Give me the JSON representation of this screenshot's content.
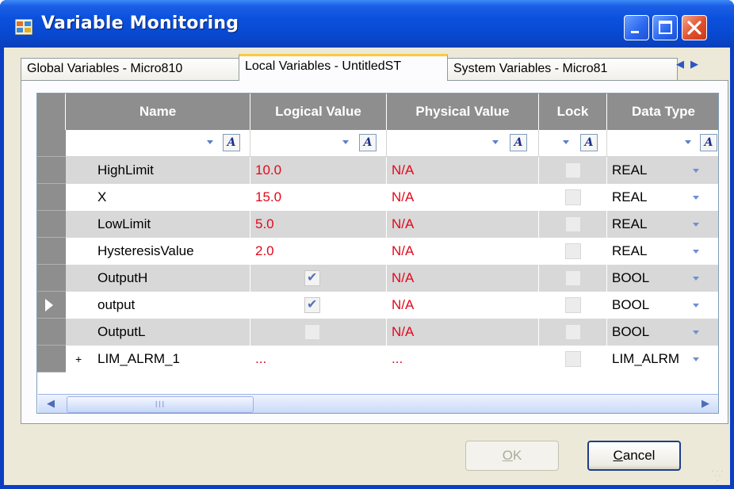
{
  "window": {
    "title": "Variable Monitoring",
    "colors": {
      "titlebar": "#0a50dc",
      "close": "#e0502d",
      "value_red": "#e2081c"
    }
  },
  "tabs": [
    {
      "label": "Global Variables - Micro810",
      "active": false
    },
    {
      "label": "Local Variables - UntitledST",
      "active": true
    },
    {
      "label": "System Variables - Micro81",
      "active": false
    }
  ],
  "tab_scroll_icons": [
    "chevron-left-icon",
    "chevron-right-icon"
  ],
  "grid": {
    "columns": [
      "Name",
      "Logical Value",
      "Physical Value",
      "Lock",
      "Data Type"
    ],
    "filter_icon": "text-filter-icon",
    "rows": [
      {
        "name": "HighLimit",
        "logical": "10.0",
        "physical": "N/A",
        "logical_kind": "text",
        "type": "REAL",
        "shaded": true
      },
      {
        "name": "X",
        "logical": "15.0",
        "physical": "N/A",
        "logical_kind": "text",
        "type": "REAL",
        "shaded": false
      },
      {
        "name": "LowLimit",
        "logical": "5.0",
        "physical": "N/A",
        "logical_kind": "text",
        "type": "REAL",
        "shaded": true
      },
      {
        "name": "HysteresisValue",
        "logical": "2.0",
        "physical": "N/A",
        "logical_kind": "text",
        "type": "REAL",
        "shaded": false
      },
      {
        "name": "OutputH",
        "logical_checked": true,
        "physical": "N/A",
        "logical_kind": "check",
        "type": "BOOL",
        "shaded": true
      },
      {
        "name": "output",
        "logical_checked": true,
        "physical": "N/A",
        "logical_kind": "check",
        "type": "BOOL",
        "shaded": false,
        "current": true
      },
      {
        "name": "OutputL",
        "logical_checked": false,
        "physical": "N/A",
        "logical_kind": "check",
        "type": "BOOL",
        "shaded": true
      },
      {
        "name": "LIM_ALRM_1",
        "logical": "...",
        "physical": "...",
        "logical_kind": "text",
        "type": "LIM_ALRM",
        "shaded": false,
        "expandable": true
      }
    ],
    "scrollbar_grip": "III"
  },
  "buttons": {
    "ok": "OK",
    "ok_mnemonic": "O",
    "ok_rest": "K",
    "cancel_mnemonic": "C",
    "cancel_rest": "ancel"
  }
}
